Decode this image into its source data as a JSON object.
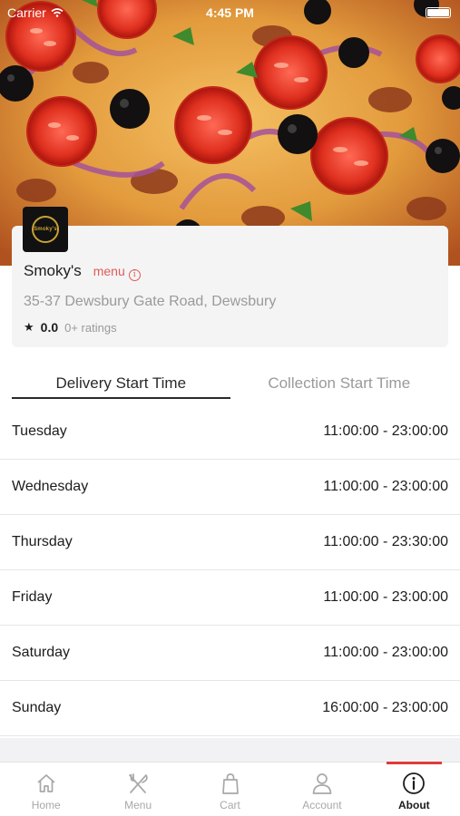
{
  "status_bar": {
    "carrier": "Carrier",
    "time": "4:45 PM"
  },
  "restaurant": {
    "logo_text": "Smoky's",
    "name": "Smoky's",
    "menu_label": "menu",
    "address": "35-37 Dewsbury Gate Road, Dewsbury",
    "rating": "0.0",
    "rating_count": "0+ ratings"
  },
  "tabs": [
    {
      "label": "Delivery Start Time",
      "active": true
    },
    {
      "label": "Collection Start Time",
      "active": false
    }
  ],
  "hours": [
    {
      "day": "Tuesday",
      "time": "11:00:00 - 23:00:00"
    },
    {
      "day": "Wednesday",
      "time": "11:00:00 - 23:00:00"
    },
    {
      "day": "Thursday",
      "time": "11:00:00 - 23:30:00"
    },
    {
      "day": "Friday",
      "time": "11:00:00 - 23:00:00"
    },
    {
      "day": "Saturday",
      "time": "11:00:00 - 23:00:00"
    },
    {
      "day": "Sunday",
      "time": "16:00:00 - 23:00:00"
    }
  ],
  "nav": [
    {
      "label": "Home",
      "icon": "home-icon",
      "active": false
    },
    {
      "label": "Menu",
      "icon": "fork-knife-icon",
      "active": false
    },
    {
      "label": "Cart",
      "icon": "bag-icon",
      "active": false
    },
    {
      "label": "Account",
      "icon": "person-icon",
      "active": false
    },
    {
      "label": "About",
      "icon": "info-circle-icon",
      "active": true
    }
  ],
  "colors": {
    "accent": "#e03a3a",
    "menu_link": "#e05a5a",
    "logo_gold": "#c9a135"
  }
}
